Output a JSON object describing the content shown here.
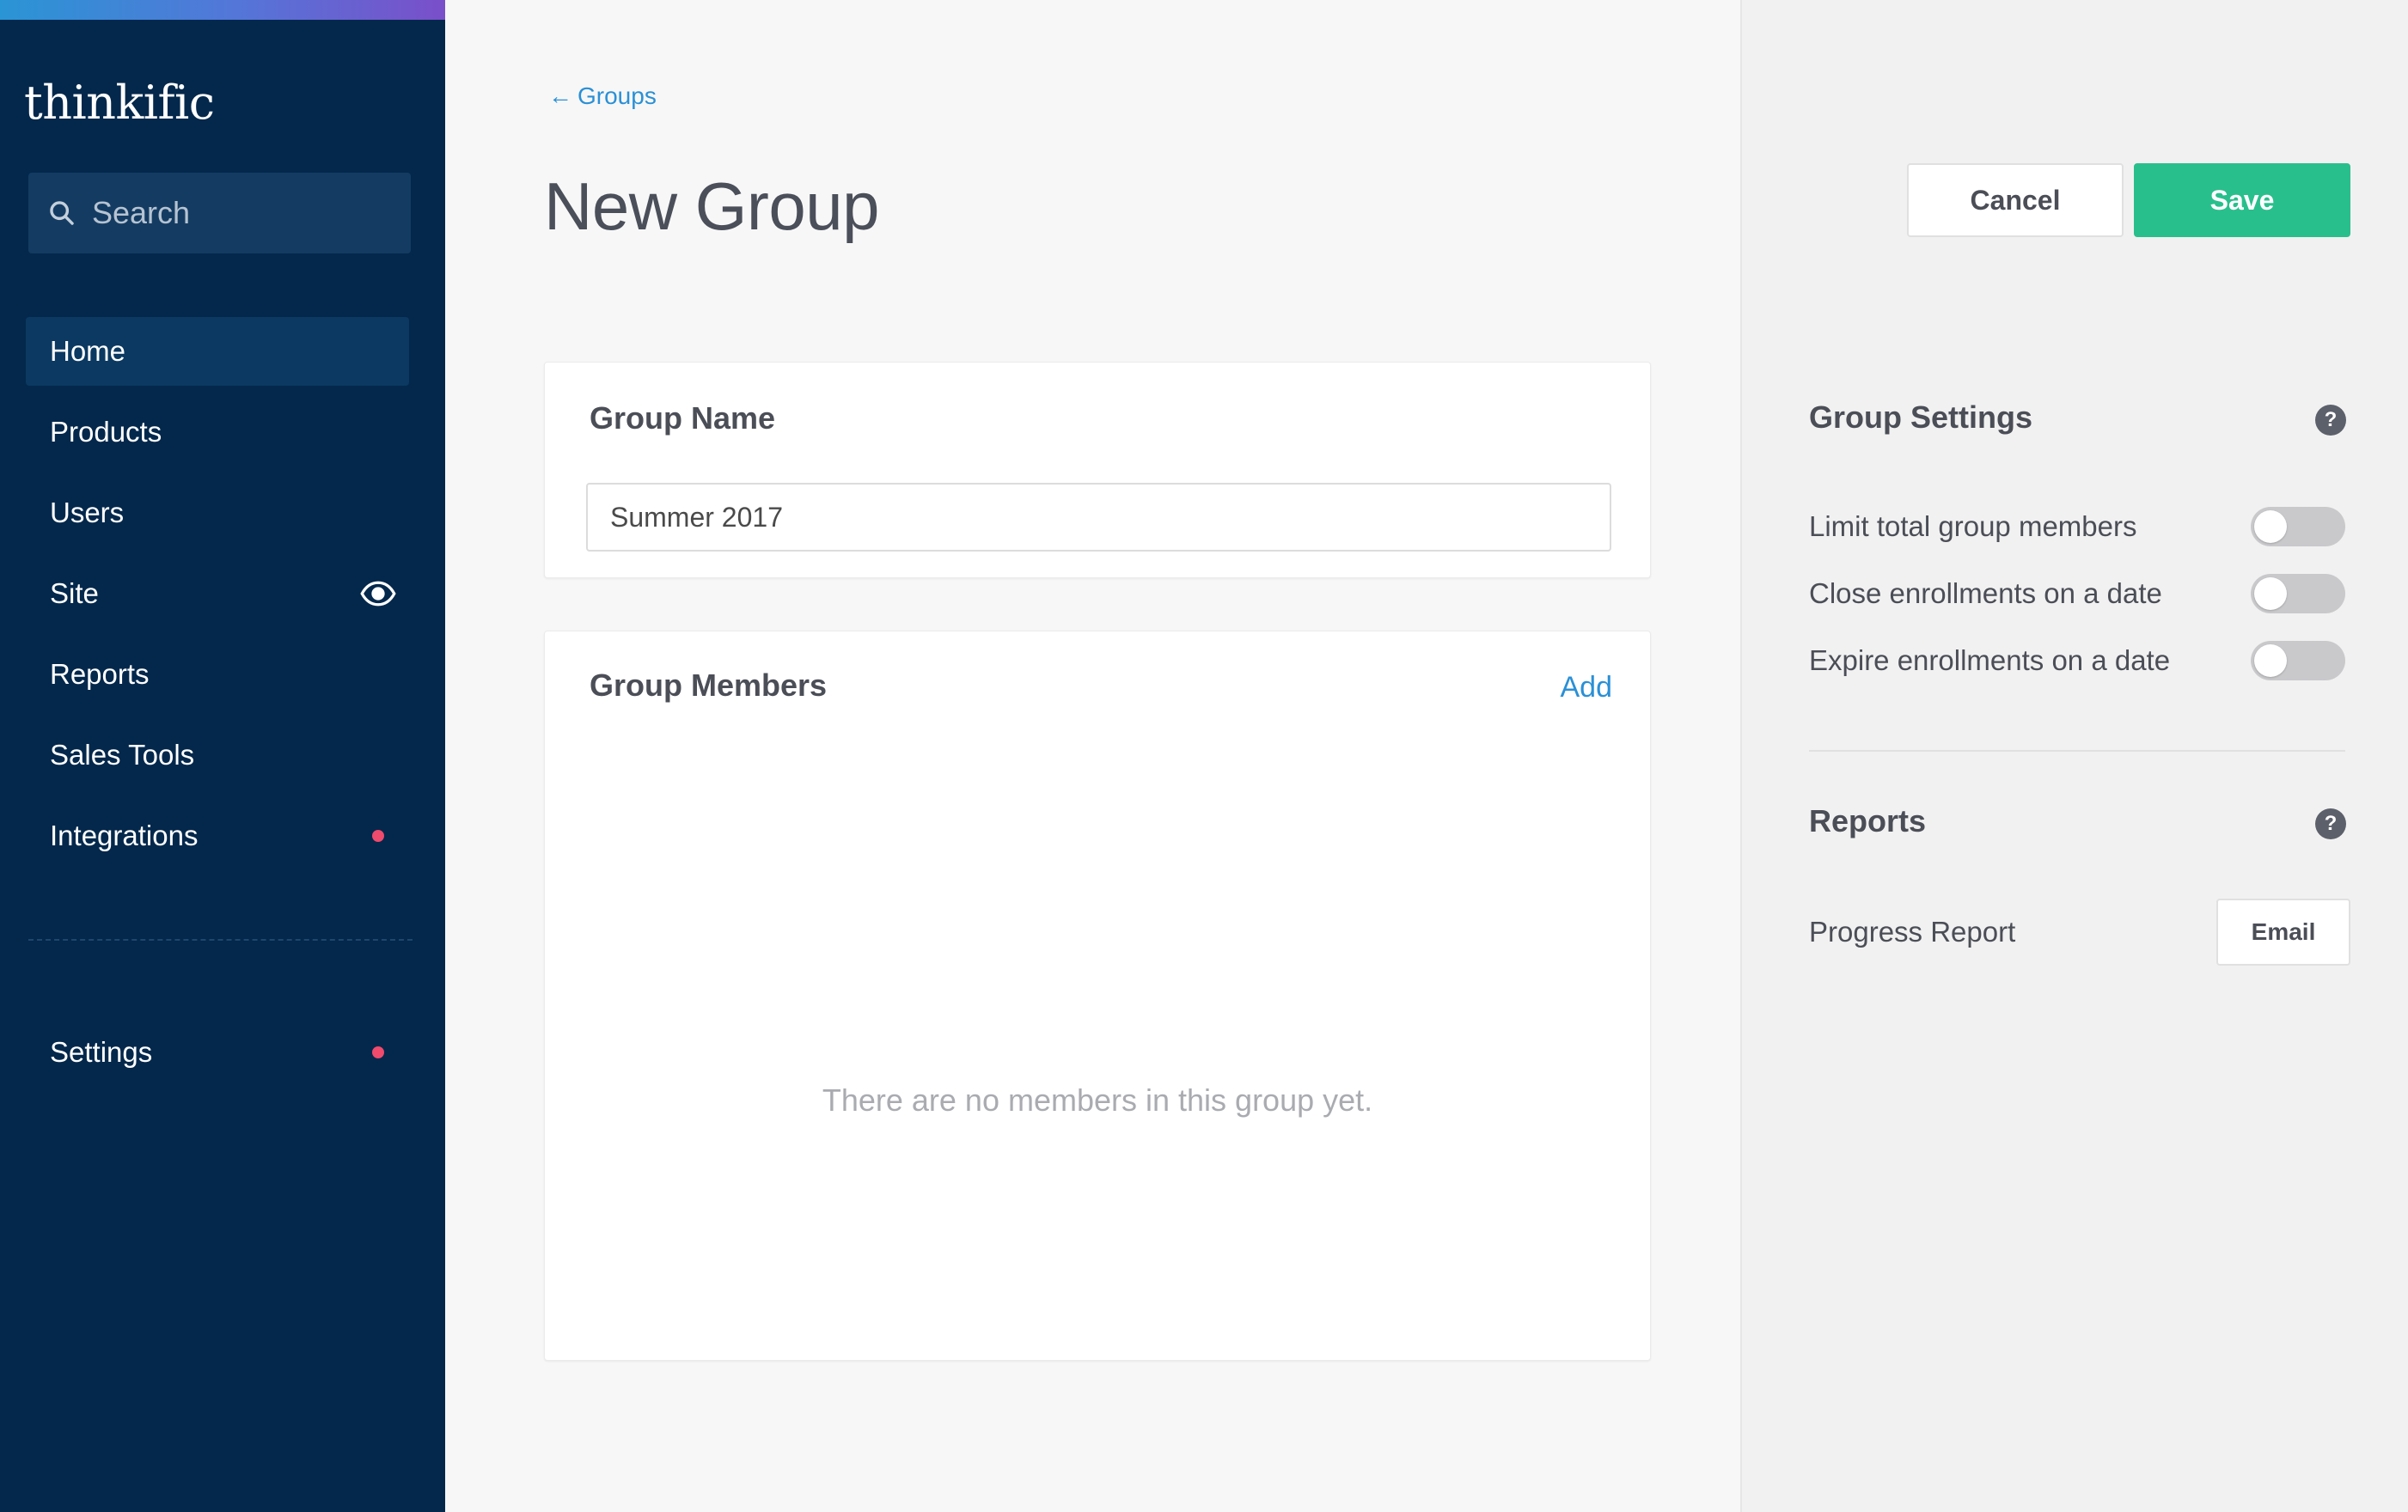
{
  "sidebar": {
    "logo": "thinkific",
    "search_placeholder": "Search",
    "items": [
      {
        "label": "Home"
      },
      {
        "label": "Products"
      },
      {
        "label": "Users"
      },
      {
        "label": "Site",
        "icon": "eye-icon"
      },
      {
        "label": "Reports"
      },
      {
        "label": "Sales Tools"
      },
      {
        "label": "Integrations",
        "badge": "notification-dot"
      }
    ],
    "settings": {
      "label": "Settings",
      "badge": "notification-dot"
    },
    "active_item": "Home"
  },
  "main": {
    "breadcrumb": {
      "arrow": "←",
      "label": "Groups"
    },
    "title": "New Group",
    "group_name": {
      "title": "Group Name",
      "value": "Summer 2017"
    },
    "group_members": {
      "title": "Group Members",
      "add_label": "Add",
      "empty_message": "There are no members in this group yet."
    }
  },
  "panel": {
    "cancel_label": "Cancel",
    "save_label": "Save",
    "group_settings": {
      "title": "Group Settings",
      "help": "?",
      "options": [
        {
          "label": "Limit total group members",
          "enabled": false
        },
        {
          "label": "Close enrollments on a date",
          "enabled": false
        },
        {
          "label": "Expire enrollments on a date",
          "enabled": false
        }
      ]
    },
    "reports": {
      "title": "Reports",
      "help": "?",
      "progress_report_label": "Progress Report",
      "email_label": "Email"
    }
  },
  "colors": {
    "sidebar_bg": "#04284c",
    "accent_blue": "#2a90d6",
    "save_green": "#29bf8d",
    "notification_dot": "#f04a6c"
  }
}
